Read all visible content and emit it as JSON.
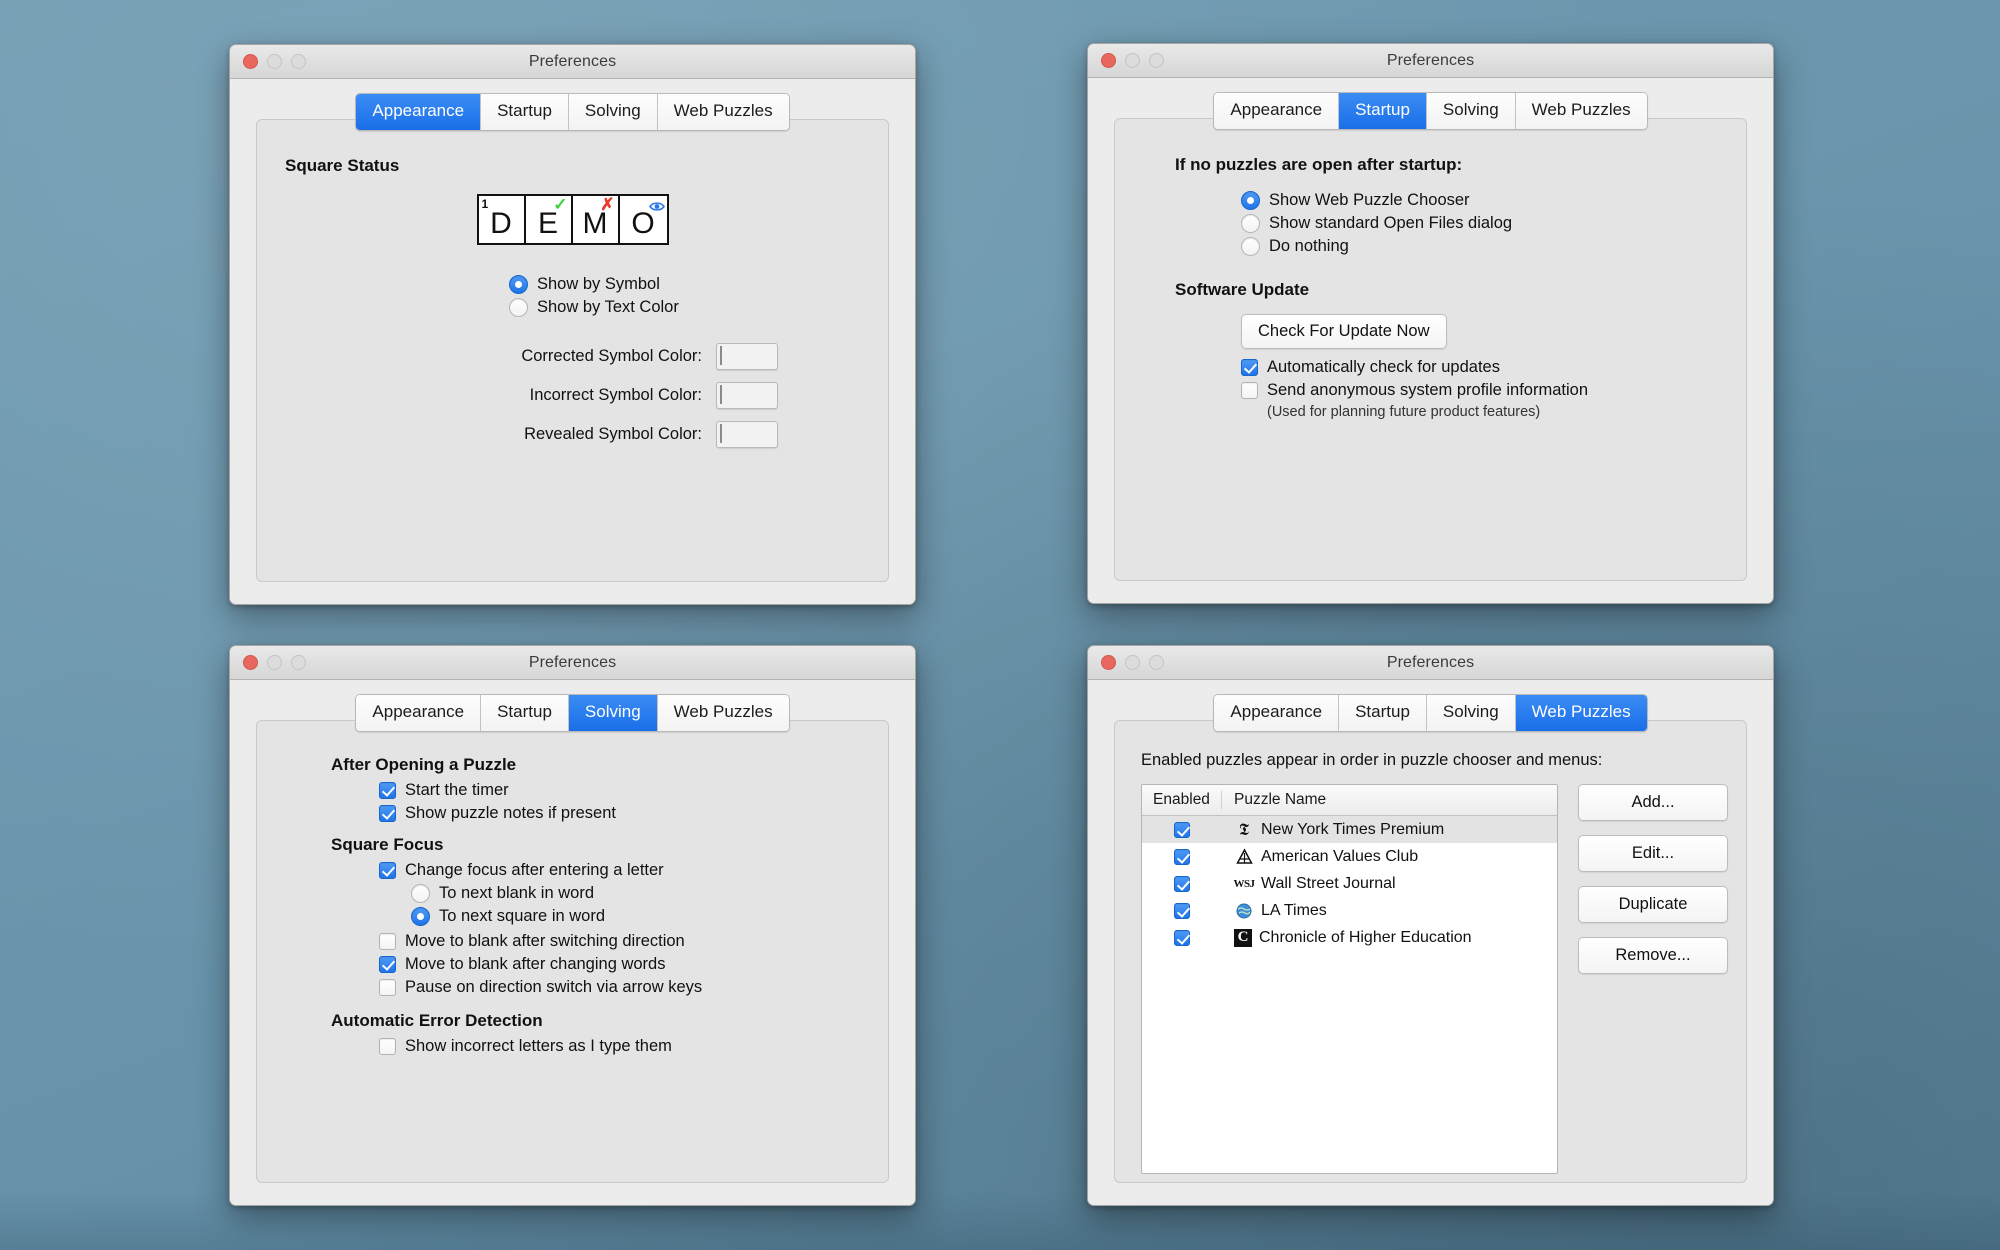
{
  "window_title": "Preferences",
  "tabs": [
    "Appearance",
    "Startup",
    "Solving",
    "Web Puzzles"
  ],
  "traffic_lights": {
    "close": "close-button",
    "minimize": "minimize-button",
    "zoom": "zoom-button"
  },
  "appearance": {
    "active_tab": "Appearance",
    "section_title": "Square Status",
    "demo_cells": [
      {
        "letter": "D",
        "number": "1",
        "mark": "none"
      },
      {
        "letter": "E",
        "number": "",
        "mark": "check"
      },
      {
        "letter": "M",
        "number": "",
        "mark": "cross"
      },
      {
        "letter": "O",
        "number": "",
        "mark": "eye"
      }
    ],
    "display_mode_options": [
      {
        "label": "Show by Symbol",
        "selected": true
      },
      {
        "label": "Show by Text Color",
        "selected": false
      }
    ],
    "colors": [
      {
        "label": "Corrected Symbol Color:",
        "value": "#5ee05a"
      },
      {
        "label": "Incorrect Symbol Color:",
        "value": "#e84a3c"
      },
      {
        "label": "Revealed Symbol Color:",
        "value": "#3179e8"
      }
    ]
  },
  "startup": {
    "active_tab": "Startup",
    "section_title": "If no puzzles are open after startup:",
    "options": [
      {
        "label": "Show Web Puzzle Chooser",
        "selected": true
      },
      {
        "label": "Show standard Open Files dialog",
        "selected": false
      },
      {
        "label": "Do nothing",
        "selected": false
      }
    ],
    "update_section_title": "Software Update",
    "check_button": "Check For Update Now",
    "checkboxes": [
      {
        "label": "Automatically check for updates",
        "checked": true
      },
      {
        "label": "Send anonymous system profile information",
        "checked": false
      }
    ],
    "hint": "(Used for planning future product features)"
  },
  "solving": {
    "active_tab": "Solving",
    "groups": [
      {
        "title": "After Opening a Puzzle",
        "items": [
          {
            "type": "checkbox",
            "label": "Start the timer",
            "checked": true,
            "indent": 0
          },
          {
            "type": "checkbox",
            "label": "Show puzzle notes if present",
            "checked": true,
            "indent": 0
          }
        ]
      },
      {
        "title": "Square Focus",
        "items": [
          {
            "type": "checkbox",
            "label": "Change focus after entering a letter",
            "checked": true,
            "indent": 0
          },
          {
            "type": "radio",
            "label": "To next blank in word",
            "checked": false,
            "indent": 1
          },
          {
            "type": "radio",
            "label": "To next square in word",
            "checked": true,
            "indent": 1
          },
          {
            "type": "checkbox",
            "label": "Move to blank after switching direction",
            "checked": false,
            "indent": 0
          },
          {
            "type": "checkbox",
            "label": "Move to blank after changing words",
            "checked": true,
            "indent": 0
          },
          {
            "type": "checkbox",
            "label": "Pause on direction switch via arrow keys",
            "checked": false,
            "indent": 0
          }
        ]
      },
      {
        "title": "Automatic Error Detection",
        "items": [
          {
            "type": "checkbox",
            "label": "Show incorrect letters as I type them",
            "checked": false,
            "indent": 0
          }
        ]
      }
    ]
  },
  "web_puzzles": {
    "active_tab": "Web Puzzles",
    "description": "Enabled puzzles appear in order in puzzle chooser and menus:",
    "columns": [
      "Enabled",
      "Puzzle Name"
    ],
    "rows": [
      {
        "enabled": true,
        "name": "New York Times Premium",
        "icon": "nyt-gothic-t-icon",
        "selected": true
      },
      {
        "enabled": true,
        "name": "American Values Club",
        "icon": "avc-triangle-icon",
        "selected": false
      },
      {
        "enabled": true,
        "name": "Wall Street Journal",
        "icon": "wsj-icon",
        "selected": false
      },
      {
        "enabled": true,
        "name": "LA Times",
        "icon": "globe-icon",
        "selected": false
      },
      {
        "enabled": true,
        "name": "Chronicle of Higher Education",
        "icon": "chronicle-c-icon",
        "selected": false
      }
    ],
    "buttons": [
      "Add...",
      "Edit...",
      "Duplicate",
      "Remove..."
    ]
  }
}
